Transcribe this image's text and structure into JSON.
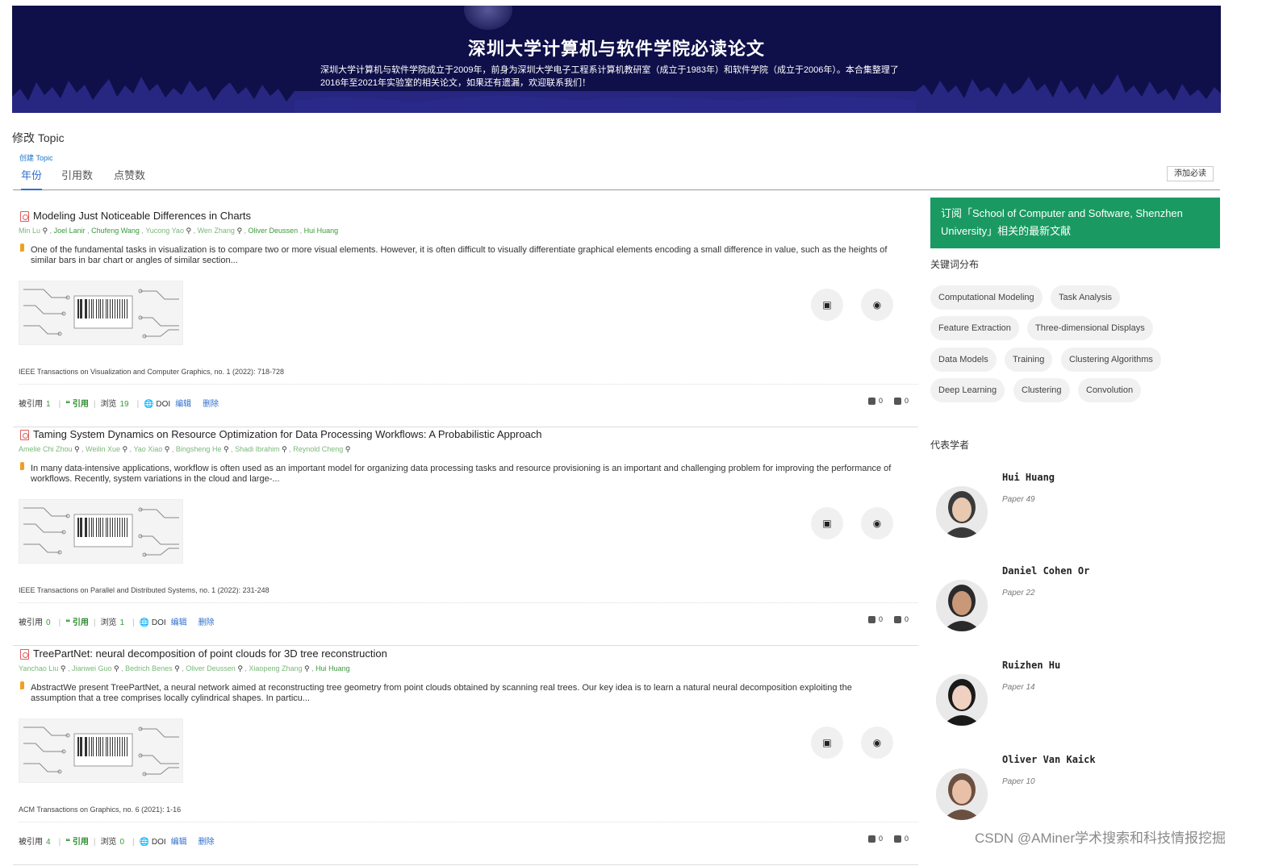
{
  "banner": {
    "title": "深圳大学计算机与软件学院必读论文",
    "description": "深圳大学计算机与软件学院成立于2009年，前身为深圳大学电子工程系计算机教研室（成立于1983年）和软件学院（成立于2006年）。本合集整理了2016年至2021年实验室的相关论文，如果还有遗漏，欢迎联系我们！"
  },
  "edit_topic": "修改 Topic",
  "create_topic": "创建 Topic",
  "tabs": [
    "年份",
    "引用数",
    "点赞数"
  ],
  "add_button": "添加必读",
  "stat_labels": {
    "cited": "被引用",
    "cite": "引用",
    "views": "浏览",
    "doi": "DOI",
    "edit": "编辑",
    "delete": "删除"
  },
  "papers": [
    {
      "title": "Modeling Just Noticeable Differences in Charts",
      "authors": [
        "Min Lu",
        "Joel Lanir",
        "Chufeng Wang",
        "Yucong Yao",
        "Wen Zhang",
        "Oliver Deussen",
        "Hui Huang"
      ],
      "abstract": "One of the fundamental tasks in visualization is to compare two or more visual elements. However, it is often difficult to visually differentiate graphical elements encoding a small difference in value, such as the heights of similar bars in bar chart or angles of similar section...",
      "venue": "IEEE Transactions on Visualization and Computer Graphics, no. 1 (2022): 718-728",
      "cited": "1",
      "views": "19",
      "likes": "0",
      "dislikes": "0"
    },
    {
      "title": "Taming System Dynamics on Resource Optimization for Data Processing Workflows: A Probabilistic Approach",
      "authors": [
        "Amelie Chi Zhou",
        "Weilin Xue",
        "Yao Xiao",
        "Bingsheng He",
        "Shadi Ibrahim",
        "Reynold Cheng"
      ],
      "abstract": "In many data-intensive applications, workflow is often used as an important model for organizing data processing tasks and resource provisioning is an important and challenging problem for improving the performance of workflows. Recently, system variations in the cloud and large-...",
      "venue": "IEEE Transactions on Parallel and Distributed Systems, no. 1 (2022): 231-248",
      "cited": "0",
      "views": "1",
      "likes": "0",
      "dislikes": "0"
    },
    {
      "title": "TreePartNet: neural decomposition of point clouds for 3D tree reconstruction",
      "authors": [
        "Yanchao Liu",
        "Jianwei Guo",
        "Bedrich Benes",
        "Oliver Deussen",
        "Xiaopeng Zhang",
        "Hui Huang"
      ],
      "abstract": "AbstractWe present TreePartNet, a neural network aimed at reconstructing tree geometry from point clouds obtained by scanning real trees. Our key idea is to learn a natural neural decomposition exploiting the assumption that a tree comprises locally cylindrical shapes. In particu...",
      "venue": "ACM Transactions on Graphics, no. 6 (2021): 1-16",
      "cited": "4",
      "views": "0",
      "likes": "0",
      "dislikes": "0"
    }
  ],
  "sidebar": {
    "subscribe": "订阅「School of Computer and Software, Shenzhen University」相关的最新文献",
    "keywords_heading": "关键词分布",
    "keywords": [
      "Computational Modeling",
      "Task Analysis",
      "Feature Extraction",
      "Three-dimensional Displays",
      "Data Models",
      "Training",
      "Clustering Algorithms",
      "Deep Learning",
      "Clustering",
      "Convolution"
    ],
    "scholars_heading": "代表学者",
    "scholars": [
      {
        "name": "Hui Huang",
        "papers": "Paper 49"
      },
      {
        "name": "Daniel Cohen Or",
        "papers": "Paper 22"
      },
      {
        "name": "Ruizhen Hu",
        "papers": "Paper 14"
      },
      {
        "name": "Oliver Van Kaick",
        "papers": "Paper 10"
      }
    ]
  },
  "watermark": "CSDN @AMiner学术搜索和科技情报挖掘",
  "colors": {
    "banner_bg": "#0f0f4a",
    "accent_blue": "#2f6fcf",
    "author_green": "#3a9a3a",
    "subscribe_green": "#1a9a62"
  }
}
